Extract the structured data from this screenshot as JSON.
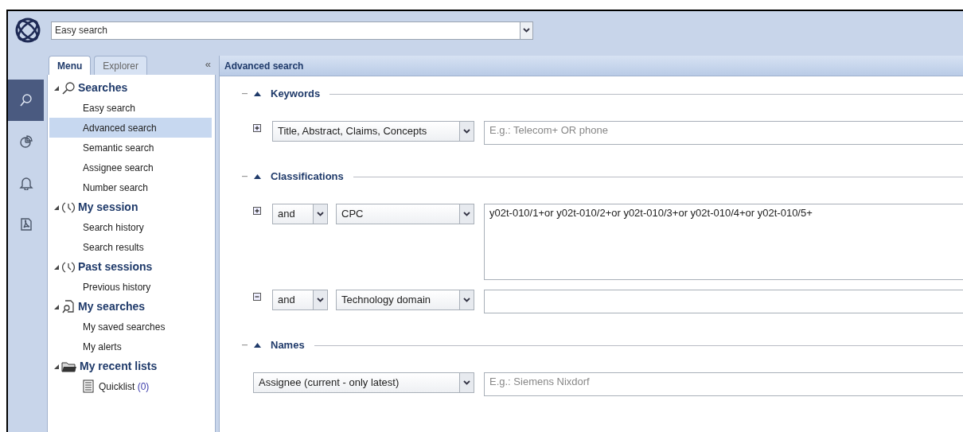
{
  "search_bar": {
    "value": "Easy search"
  },
  "rail": [
    {
      "kind": "search",
      "selected": true
    },
    {
      "kind": "chart",
      "selected": false
    },
    {
      "kind": "bell",
      "selected": false
    },
    {
      "kind": "pdf",
      "selected": false
    }
  ],
  "sidebar": {
    "tabs": [
      {
        "label": "Menu",
        "selected": true
      },
      {
        "label": "Explorer",
        "selected": false
      }
    ],
    "collapse": "«",
    "tree": [
      {
        "label": "Searches",
        "kind": "search",
        "expanded": true,
        "children": [
          {
            "label": "Easy search",
            "selected": false
          },
          {
            "label": "Advanced search",
            "selected": true
          },
          {
            "label": "Semantic search",
            "selected": false
          },
          {
            "label": "Assignee search",
            "selected": false
          },
          {
            "label": "Number search",
            "selected": false
          }
        ]
      },
      {
        "label": "My session",
        "kind": "clock",
        "expanded": true,
        "children": [
          {
            "label": "Search history",
            "selected": false
          },
          {
            "label": "Search results",
            "selected": false
          }
        ]
      },
      {
        "label": "Past sessions",
        "kind": "clock",
        "expanded": true,
        "children": [
          {
            "label": "Previous history",
            "selected": false
          }
        ]
      },
      {
        "label": "My searches",
        "kind": "doc-search",
        "expanded": true,
        "children": [
          {
            "label": "My saved searches",
            "selected": false
          },
          {
            "label": "My alerts",
            "selected": false
          }
        ]
      },
      {
        "label": "My recent lists",
        "kind": "folder",
        "expanded": true,
        "children": [
          {
            "label": "Quicklist",
            "count": "(0)",
            "kind": "list",
            "selected": false
          }
        ]
      }
    ]
  },
  "main": {
    "title": "Advanced search",
    "sections": [
      {
        "title": "Keywords",
        "expanded": true,
        "rows": [
          {
            "expanded": false,
            "field": "Title, Abstract, Claims, Concepts",
            "placeholder": "E.g.: Telecom+ OR phone"
          }
        ]
      },
      {
        "title": "Classifications",
        "expanded": true,
        "rows": [
          {
            "expanded": false,
            "operator": "and",
            "field": "CPC",
            "value": "y02t-010/1+or y02t-010/2+or y02t-010/3+or y02t-010/4+or y02t-010/5+",
            "multiline": true
          },
          {
            "expanded": true,
            "operator": "and",
            "field": "Technology domain"
          }
        ]
      },
      {
        "title": "Names",
        "expanded": true,
        "rows": [
          {
            "field": "Assignee (current - only latest)",
            "placeholder": "E.g.: Siemens Nixdorf"
          }
        ]
      }
    ]
  }
}
